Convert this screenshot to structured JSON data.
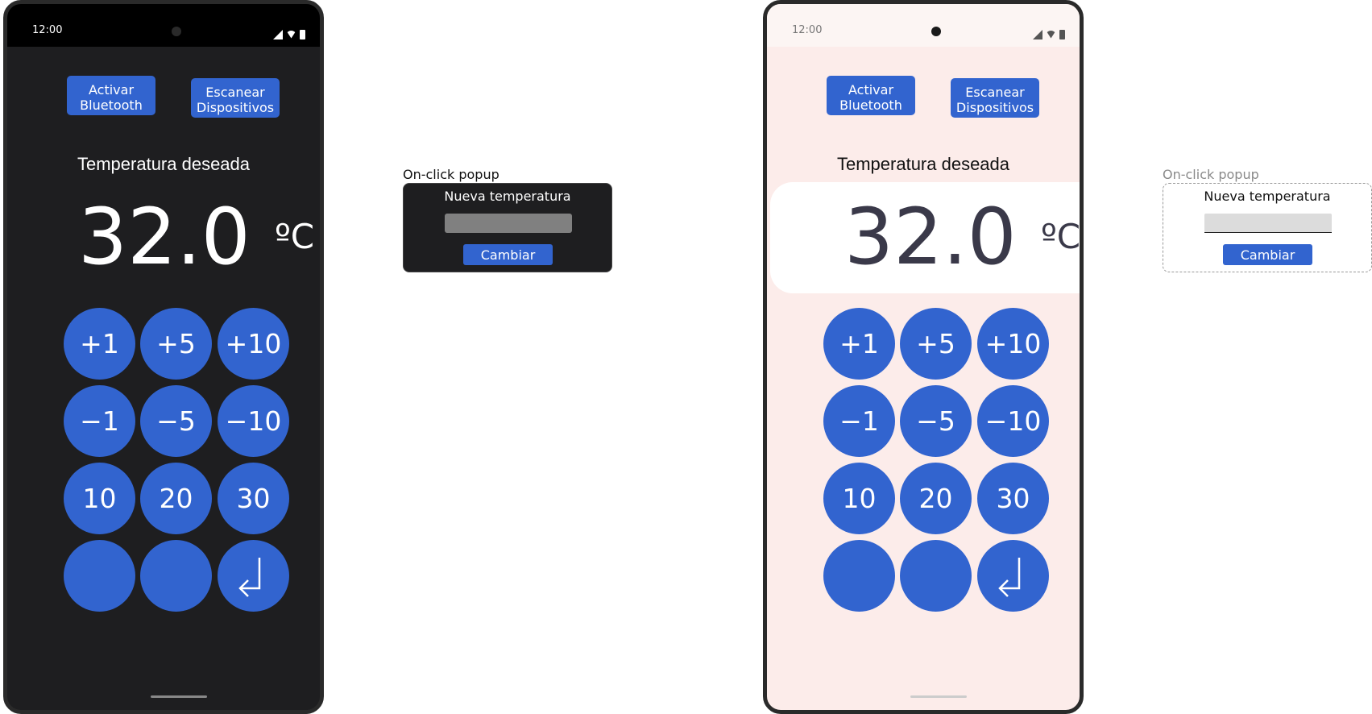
{
  "status_bar": {
    "time": "12:00"
  },
  "buttons": {
    "bluetooth": "Activar\nBluetooth",
    "bluetooth_line1": "Activar",
    "bluetooth_line2": "Bluetooth",
    "scan_line1": "Escanear",
    "scan_line2": "Dispositivos"
  },
  "temperature": {
    "title": "Temperatura deseada",
    "value": "32.0",
    "unit": "ºC"
  },
  "keypad": {
    "r0": [
      "+1",
      "+5",
      "+10"
    ],
    "r1": [
      "−1",
      "−5",
      "−10"
    ],
    "r2": [
      "10",
      "20",
      "30"
    ],
    "enter_icon": "enter-return-icon"
  },
  "popup": {
    "label": "On-click popup",
    "title": "Nueva temperatura",
    "input_value": "",
    "button": "Cambiar"
  },
  "colors": {
    "accent": "#3264cf",
    "dark_bg": "#1e1e20",
    "light_bg": "#fcecea",
    "light_temp_text": "#3a3949"
  }
}
